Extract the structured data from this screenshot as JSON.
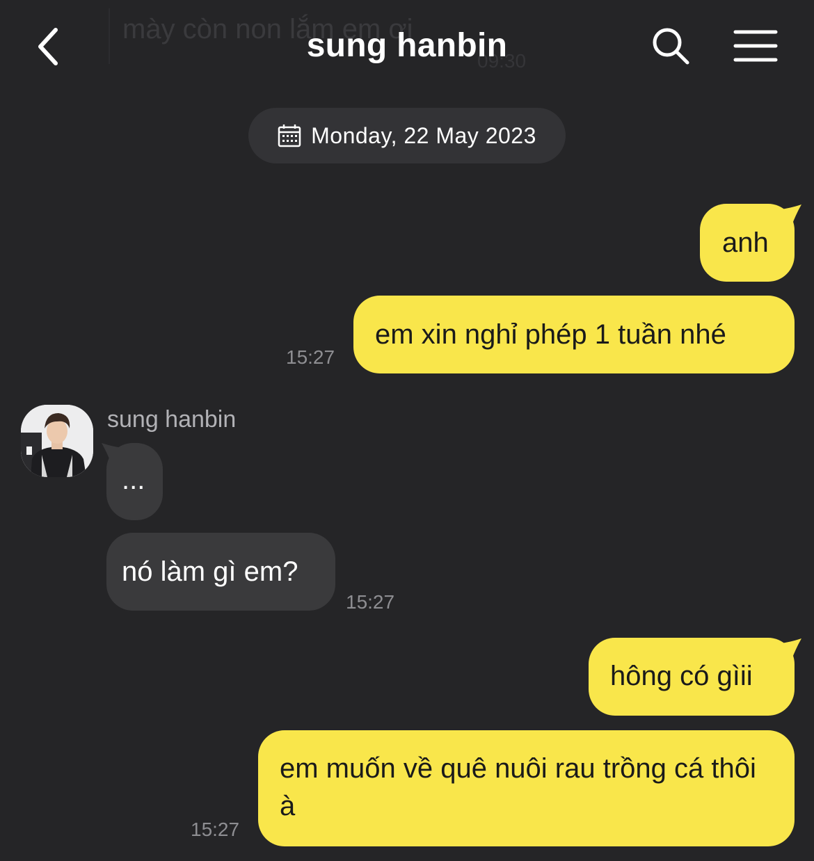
{
  "header": {
    "title": "sung hanbin",
    "back_icon": "chevron-left-icon",
    "search_icon": "search-icon",
    "menu_icon": "hamburger-menu-icon"
  },
  "ghost_message": {
    "text": "mày còn non lắm em ơi",
    "time": "09:30"
  },
  "date_divider": {
    "icon": "calendar-icon",
    "label": "Monday, 22 May 2023"
  },
  "messages": [
    {
      "sender": "me",
      "text": "anh",
      "time": ""
    },
    {
      "sender": "me",
      "text": "em xin nghỉ phép 1 tuần nhé",
      "time": "15:27"
    },
    {
      "sender": "sung hanbin",
      "text": "...",
      "time": ""
    },
    {
      "sender": "sung hanbin",
      "text": "nó làm gì em?",
      "time": "15:27"
    },
    {
      "sender": "me",
      "text": "hông có gìii",
      "time": ""
    },
    {
      "sender": "me",
      "text": "em muốn về quê nuôi rau trồng cá thôi à",
      "time": "15:27"
    }
  ],
  "contact": {
    "name": "sung hanbin",
    "avatar_icon": "avatar-photo"
  },
  "colors": {
    "background": "#252527",
    "my_bubble": "#f9e64b",
    "their_bubble": "#3a3a3c",
    "date_pill": "#333336",
    "timestamp": "#8e8e92"
  }
}
